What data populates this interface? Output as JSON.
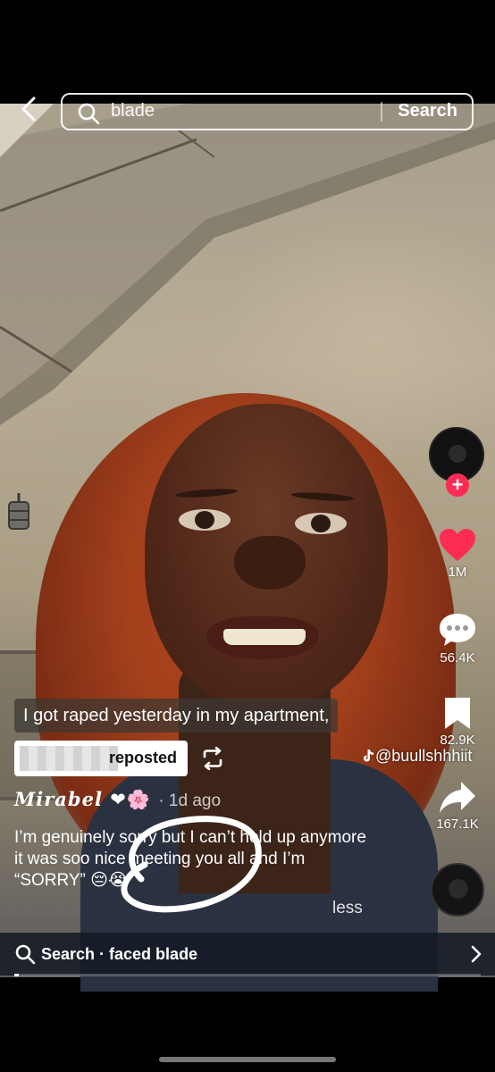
{
  "search": {
    "query": "blade",
    "button_label": "Search"
  },
  "video": {
    "on_screen_caption": "I got raped yesterday in my apartment,"
  },
  "repost": {
    "label": "reposted"
  },
  "creator_tag": "@buullshhhiit",
  "actions": {
    "likes": "1M",
    "comments": "56.4K",
    "saves": "82.9K",
    "shares": "167.1K"
  },
  "post": {
    "username": "Mirabel",
    "username_emoji": "❤🌸",
    "time_ago": "· 1d ago",
    "description": "I’m genuinely sorry but I can’t hold up anymore it was soo nice meeting you all and I’m “SORRY” 😔😭",
    "less_label": "less"
  },
  "bottom_bar": {
    "text": "Search · faced blade"
  },
  "progress": {
    "value": 0.01
  },
  "colors": {
    "like_red": "#fe2c55",
    "follow_plus": "#fe2c55"
  },
  "icons": [
    "back-arrow-icon",
    "search-icon",
    "heart-icon",
    "comment-icon",
    "bookmark-icon",
    "share-icon",
    "repost-icon",
    "tiktok-logo-icon",
    "chevron-right-icon"
  ]
}
